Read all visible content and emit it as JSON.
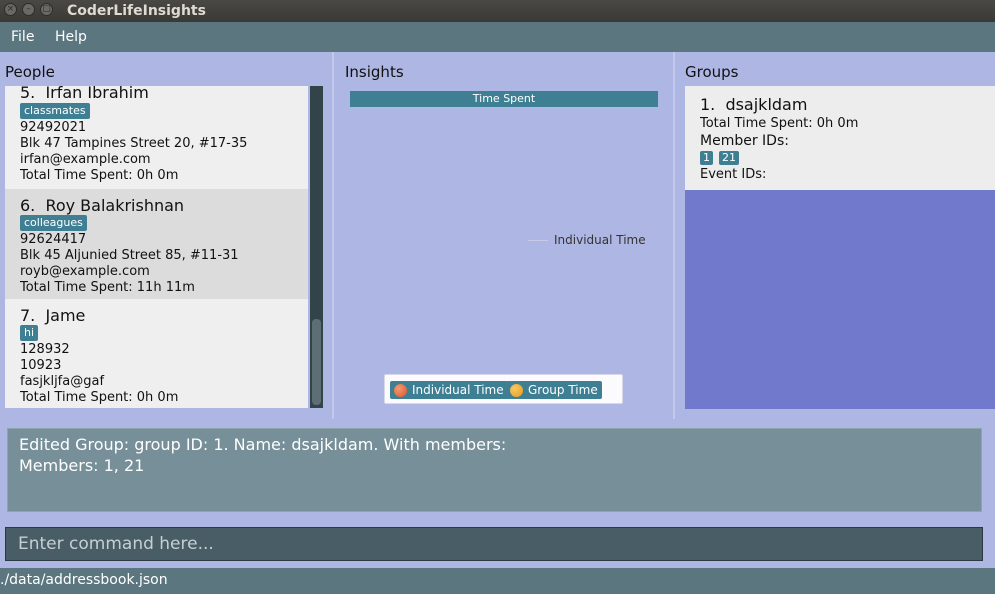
{
  "app": {
    "title": "CoderLifeInsights"
  },
  "window_buttons": [
    {
      "icon": "close-icon",
      "glyph": "×"
    },
    {
      "icon": "minimize-icon",
      "glyph": "–"
    },
    {
      "icon": "maximize-icon",
      "glyph": "□"
    }
  ],
  "menu": {
    "file": "File",
    "help": "Help"
  },
  "people": {
    "title": "People",
    "persons": [
      {
        "index": "5.",
        "name": "Irfan Ibrahim",
        "tag": "classmates",
        "phone": "92492021",
        "address": "Blk 47 Tampines Street 20, #17-35",
        "email": "irfan@example.com",
        "time": "Total Time Spent: 0h 0m"
      },
      {
        "index": "6.",
        "name": "Roy Balakrishnan",
        "tag": "colleagues",
        "phone": "92624417",
        "address": "Blk 45 Aljunied Street 85, #11-31",
        "email": "royb@example.com",
        "time": "Total Time Spent: 11h 11m"
      },
      {
        "index": "7.",
        "name": "Jame",
        "tag": "hi",
        "phone": "128932",
        "address": "10923",
        "email": "fasjkljfa@gaf",
        "time": "Total Time Spent: 0h 0m"
      }
    ]
  },
  "insights": {
    "title": "Insights",
    "chart_title": "Time Spent",
    "series_label": "Individual Time",
    "legend": [
      {
        "label": "Individual Time",
        "color": "#e0653a"
      },
      {
        "label": "Group Time",
        "color": "#f0a020"
      }
    ]
  },
  "groups": {
    "title": "Groups",
    "items": [
      {
        "index": "1.",
        "name": "dsajkldam",
        "time": "Total Time Spent: 0h 0m",
        "member_label": "Member IDs:",
        "members": [
          "1",
          "21"
        ],
        "event_label": "Event IDs:"
      }
    ]
  },
  "result": {
    "line1": "Edited Group: group ID: 1. Name: dsajkldam. With members:",
    "line2": "Members: 1, 21"
  },
  "command": {
    "placeholder": "Enter command here..."
  },
  "status": {
    "path": "./data/addressbook.json"
  },
  "colors": {
    "tag": "#3f7f93",
    "accent": "#7079cc",
    "panel": "#aeb6e3"
  }
}
